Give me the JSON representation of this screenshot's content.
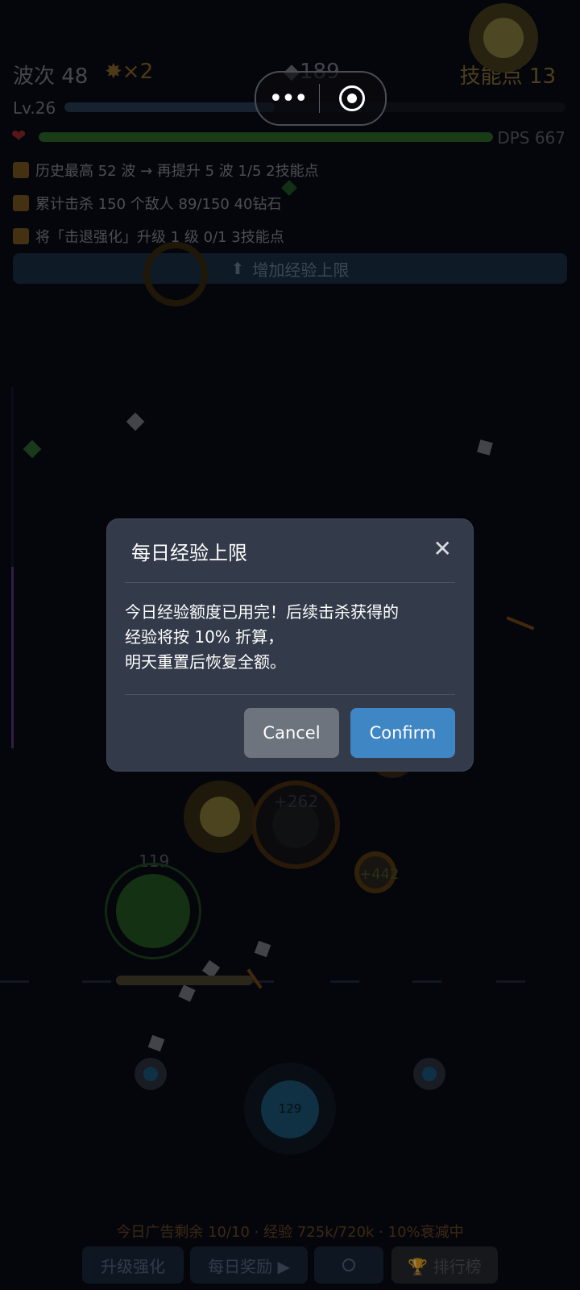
{
  "hud": {
    "wave": "波次 48",
    "multiplier": "×2",
    "gems": "189",
    "skill_points": "技能点 13",
    "level": "Lv.26",
    "xp_fraction": 0.42,
    "hp_fraction": 1.0,
    "dps": "DPS 667"
  },
  "quests": [
    {
      "text": "历史最高 52 波 → 再提升 5 波  1/5  2技能点"
    },
    {
      "text": "累计击杀 150 个敌人  89/150  40钻石"
    },
    {
      "text": "将「击退强化」升级 1 级  0/1  3技能点"
    }
  ],
  "upgrade_bar": {
    "label": "增加经验上限"
  },
  "capsule": {
    "more": "•••"
  },
  "game": {
    "floating_text_1": "+262",
    "floating_text_2": "+442",
    "green_enemy_hp": "119",
    "player_value": "129"
  },
  "footer": {
    "ads_text": "今日广告剩余 10/10 · 经验 725k/720k · 10%衰减中",
    "buttons": [
      "升级强化",
      "每日奖励 ▶",
      "",
      "🏆 排行榜"
    ]
  },
  "modal": {
    "title": "每日经验上限",
    "close": "✕",
    "body_line1": "今日经验额度已用完！后续击杀获得的",
    "body_line2": "经验将按 10% 折算，",
    "body_line3": "明天重置后恢复全额。",
    "cancel": "Cancel",
    "confirm": "Confirm"
  },
  "colors": {
    "confirm": "#3f86c5",
    "cancel": "#6e747e",
    "modal_bg": "#333a49"
  }
}
